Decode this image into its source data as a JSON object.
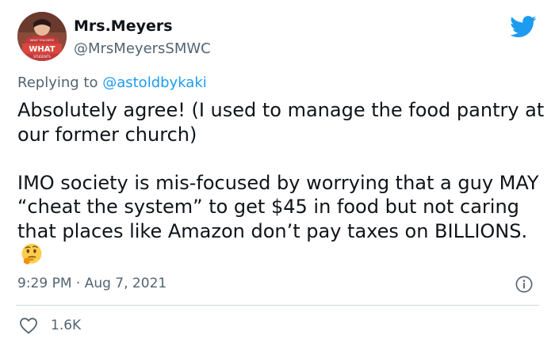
{
  "tweet": {
    "display_name": "Mrs.Meyers",
    "handle": "@MrsMeyersSMWC",
    "reply_prefix": "Replying to",
    "reply_to": "@astoldbykaki",
    "paragraphs": [
      "Absolutely agree! (I used to manage the food pantry at our former church)",
      "IMO  society is mis-focused by worrying that a guy MAY “cheat the system” to get $45 in food but not caring that places like Amazon don’t pay taxes on BILLIONS."
    ],
    "timestamp": "9:29 PM · Aug 7, 2021",
    "like_count": "1.6K",
    "avatar_sign_text": "WHAT",
    "icons": {
      "logo": "twitter-bird-icon",
      "emoji": "thinking-face-emoji-icon",
      "info": "info-icon",
      "like": "heart-icon"
    }
  },
  "colors": {
    "text": "#0f1419",
    "secondary": "#536471",
    "accent": "#1d9bf0",
    "divider": "#cfd9de",
    "avatar_sign": "#c23a3a"
  }
}
